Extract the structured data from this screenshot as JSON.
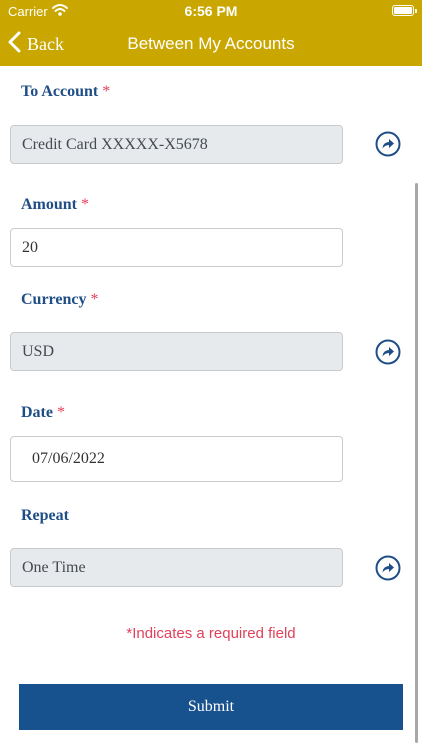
{
  "status_bar": {
    "carrier": "Carrier",
    "time": "6:56 PM"
  },
  "nav": {
    "back_label": "Back",
    "title": "Between My Accounts"
  },
  "fields": {
    "to_account": {
      "label": "To Account",
      "required_mark": "*",
      "value": "Credit Card XXXXX-X5678"
    },
    "amount": {
      "label": "Amount",
      "required_mark": "*",
      "value": "20"
    },
    "currency": {
      "label": "Currency",
      "required_mark": "*",
      "value": "USD"
    },
    "date": {
      "label": "Date",
      "required_mark": "*",
      "value": "07/06/2022"
    },
    "repeat": {
      "label": "Repeat",
      "value": "One Time"
    }
  },
  "required_note": "*Indicates a required field",
  "submit_label": "Submit",
  "colors": {
    "header": "#c9a700",
    "label": "#1f4e86",
    "required": "#e0415b",
    "button": "#17528f"
  },
  "icons": {
    "back": "chevron-left-icon",
    "select": "forward-arrow-circle-icon"
  }
}
